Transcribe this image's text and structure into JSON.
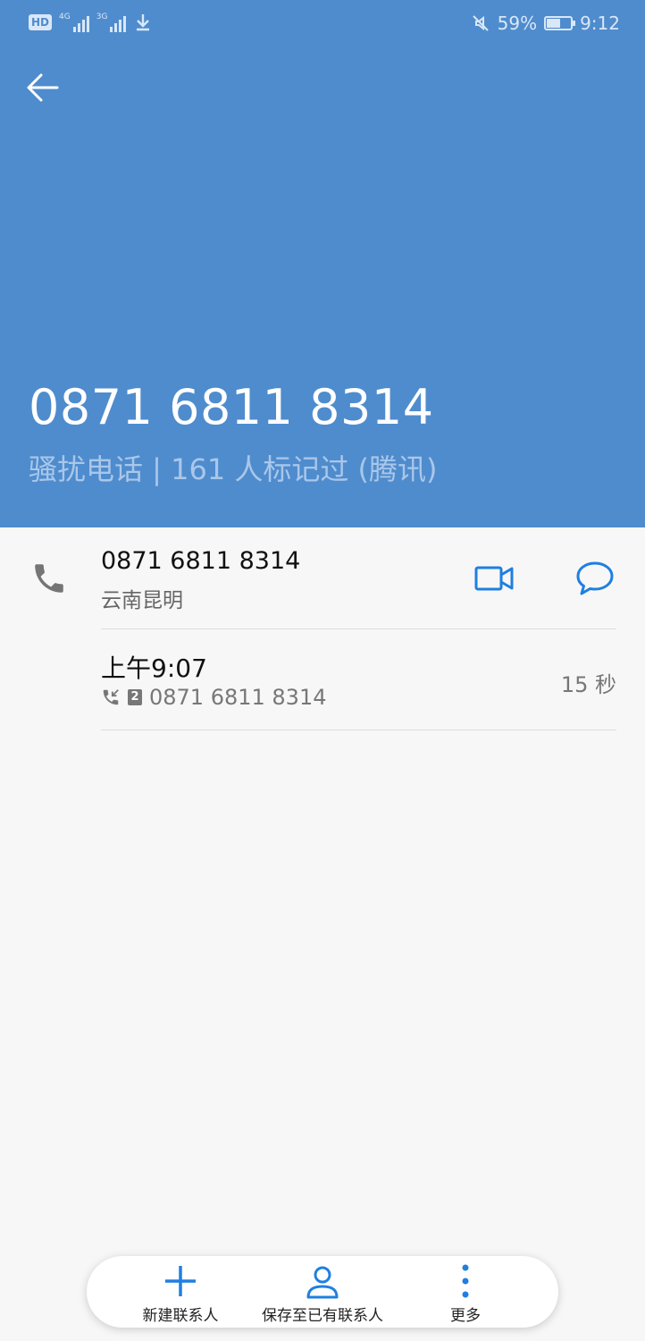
{
  "status_bar": {
    "hd": "HD",
    "sim1_net": "4G",
    "sim2_net": "3G",
    "battery_pct": "59%",
    "battery_level": 0.59,
    "time": "9:12",
    "icons": [
      "signal-icon",
      "download-icon",
      "mute-icon",
      "battery-icon"
    ]
  },
  "header": {
    "number": "0871 6811 8314",
    "tag": "骚扰电话 | 161 人标记过 (腾讯)",
    "bg_color": "#4f8ccd"
  },
  "contact_row": {
    "number": "0871 6811 8314",
    "location": "云南昆明",
    "accent": "#1f7fe0"
  },
  "call_log": {
    "time": "上午9:07",
    "sim": "2",
    "number": "0871 6811 8314",
    "duration": "15 秒"
  },
  "bottom_bar": {
    "new_contact": "新建联系人",
    "save_existing": "保存至已有联系人",
    "more": "更多"
  }
}
